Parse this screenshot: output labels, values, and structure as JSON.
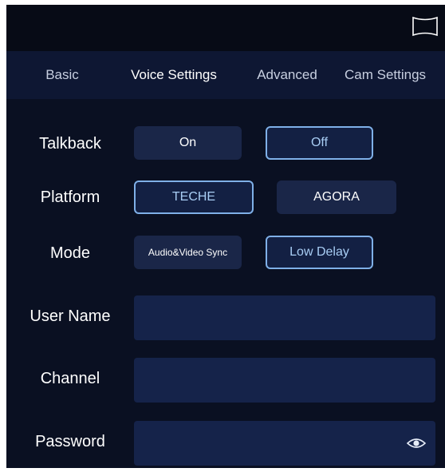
{
  "tabs": [
    {
      "label": "Basic"
    },
    {
      "label": "Voice Settings"
    },
    {
      "label": "Advanced"
    },
    {
      "label": "Cam Settings"
    }
  ],
  "active_tab": "Voice Settings",
  "talkback": {
    "label": "Talkback",
    "options": [
      "On",
      "Off"
    ],
    "selected": "Off"
  },
  "platform": {
    "label": "Platform",
    "options": [
      "TECHE",
      "AGORA"
    ],
    "selected": "TECHE"
  },
  "mode": {
    "label": "Mode",
    "options": [
      "Audio&Video Sync",
      "Low Delay"
    ],
    "selected": "Low Delay"
  },
  "fields": {
    "user_name": {
      "label": "User Name",
      "value": ""
    },
    "channel": {
      "label": "Channel",
      "value": ""
    },
    "password": {
      "label": "Password",
      "value": ""
    }
  },
  "icons": {
    "fullscreen": "fullscreen-icon",
    "eye": "eye-icon"
  },
  "colors": {
    "background": "#0a1022",
    "tab_bar": "#0e1733",
    "button": "#1a2648",
    "selected_border": "#7fb0e8",
    "field": "#15234a"
  }
}
